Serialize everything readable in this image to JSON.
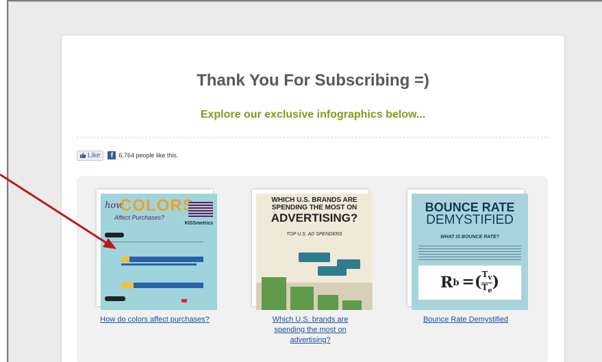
{
  "page": {
    "title": "Thank You For Subscribing =)",
    "subtitle": "Explore our exclusive infographics below..."
  },
  "social": {
    "like_label": "Like",
    "fb_icon_glyph": "f",
    "count_text": "6,764 people like this."
  },
  "infographics": [
    {
      "caption": "How do colors affect purchases?",
      "art": {
        "how": "how",
        "colors": "COLORS",
        "affect": "Affect Purchases?",
        "brand": "KISSmetrics"
      }
    },
    {
      "caption": "Which U.S. brands are spending the most on advertising?",
      "art": {
        "line1": "WHICH U.S. BRANDS ARE",
        "line2": "SPENDING THE MOST ON",
        "line3": "ADVERTISING?",
        "sub": "TOP U.S. AD SPENDERS"
      }
    },
    {
      "caption": "Bounce Rate Demystified",
      "art": {
        "line1": "BOUNCE RATE",
        "line2": "DEMYSTIFIED",
        "sub": "WHAT IS BOUNCE RATE?",
        "formula": "R",
        "formula_sub": "b"
      }
    }
  ],
  "colors": {
    "accent_green": "#7f9a1c",
    "link_blue": "#1a4fa0",
    "arrow_red": "#c0171c"
  }
}
